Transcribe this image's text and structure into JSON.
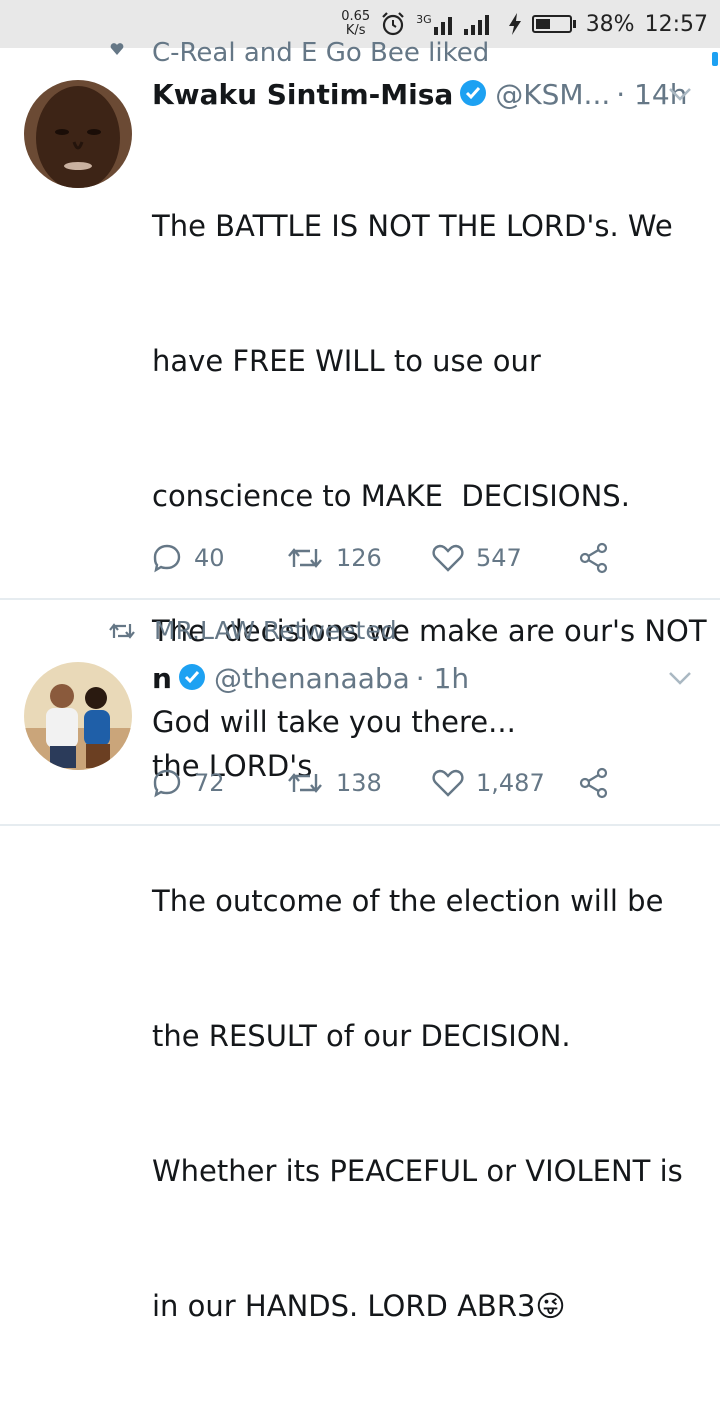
{
  "status_bar": {
    "speed_value": "0.65",
    "speed_unit": "K/s",
    "network": "3G",
    "battery": "38%",
    "time": "12:57",
    "icons": [
      "alarm-icon",
      "signal-icon",
      "charging-icon",
      "battery-icon"
    ]
  },
  "liked_banner": {
    "text": "C-Real and E Go Bee liked"
  },
  "tweet1": {
    "name": "Kwaku Sintim-Misa",
    "handle": "@KSM...",
    "time": "· 14h",
    "lines": [
      "The BATTLE IS NOT THE LORD's. We",
      "have FREE WILL to use our",
      "conscience to MAKE  DECISIONS.",
      "The  decisions we make are our's NOT",
      "the LORD's",
      "The outcome of the election will be",
      "the RESULT of our DECISION.",
      "Whether its PEACEFUL or VIOLENT is",
      "in our HANDS. LORD ABR3"
    ],
    "emoji": "😜",
    "replies": "40",
    "retweets": "126",
    "likes": "547"
  },
  "retweet_banner": {
    "text": "MR.LAW Retweeted"
  },
  "tweet2": {
    "name": "n",
    "handle": "@thenanaaba",
    "time": "· 1h",
    "text": "God will take you there...",
    "replies": "72",
    "retweets": "138",
    "likes": "1,487"
  },
  "colors": {
    "accent": "#1da1f2",
    "muted": "#657786",
    "text": "#14171a",
    "status_bar": "#e8e8e8"
  }
}
